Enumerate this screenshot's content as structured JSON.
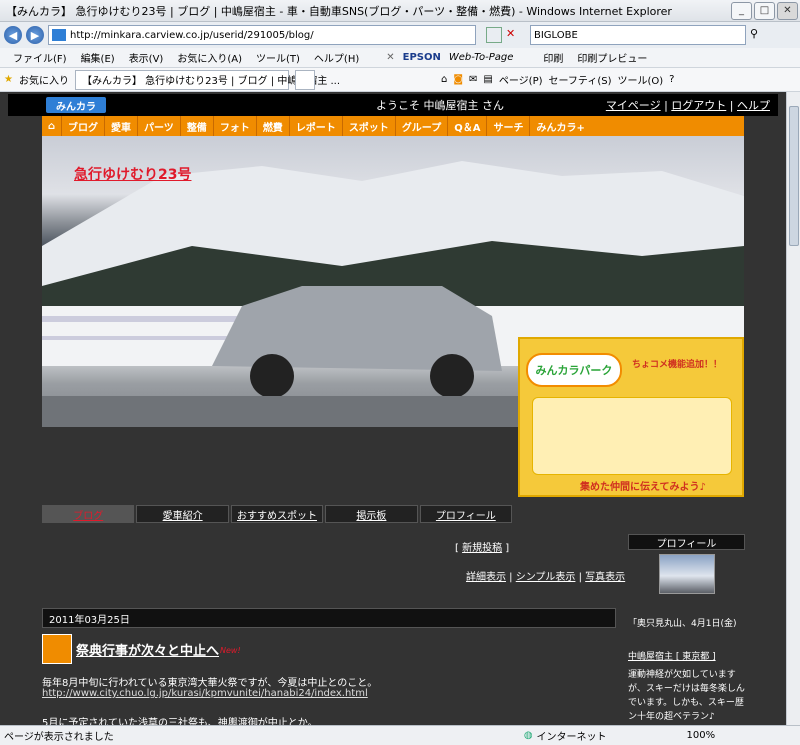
{
  "window": {
    "title": "【みんカラ】 急行ゆけむり23号 | ブログ | 中嶋屋宿主 - 車・自動車SNS(ブログ・パーツ・整備・燃費) - Windows Internet Explorer"
  },
  "address": {
    "url": "http://minkara.carview.co.jp/userid/291005/blog/",
    "search_engine": "BIGLOBE"
  },
  "menu": [
    "ファイル(F)",
    "編集(E)",
    "表示(V)",
    "お気に入り(A)",
    "ツール(T)",
    "ヘルプ(H)"
  ],
  "toolbar": {
    "epson": "EPSON",
    "webtopage": "Web-To-Page",
    "print": "印刷",
    "preview": "印刷プレビュー"
  },
  "favbar": {
    "favorites": "お気に入り",
    "tab": "【みんカラ】 急行ゆけむり23号 | ブログ | 中嶋屋宿主 ...",
    "page": "ページ(P)",
    "safety": "セーフティ(S)",
    "tools": "ツール(O)"
  },
  "site": {
    "logo": "みんカラ",
    "welcome": "ようこそ 中嶋屋宿主 さん",
    "toplinks": [
      "マイページ",
      "ログアウト",
      "ヘルプ"
    ],
    "nav": [
      "ブログ",
      "愛車",
      "パーツ",
      "整備",
      "フォト",
      "燃費",
      "レポート",
      "スポット",
      "グループ",
      "Q＆A",
      "サーチ",
      "みんカラ+"
    ]
  },
  "blog": {
    "title": "急行ゆけむり23号"
  },
  "ad": {
    "logo": "みんカラパーク",
    "line1": "ちょコメ機能追加！！",
    "line2": "集めた仲間に伝えてみよう♪"
  },
  "blogtabs": [
    "ブログ",
    "愛車紹介",
    "おすすめスポット",
    "掲示板",
    "プロフィール"
  ],
  "post": {
    "new_post": "新規投稿",
    "views": [
      "詳細表示",
      "シンプル表示",
      "写真表示"
    ]
  },
  "entry": {
    "date": "2011年03月25日",
    "title": "祭典行事が次々と中止へ",
    "new_badge": "New!",
    "body1": "毎年8月中旬に行われている東京湾大華火祭ですが、今夏は中止とのこと。",
    "link": "http://www.city.chuo.lg.jp/kurasi/kpmvunitei/hanabi24/index.html",
    "body2": "5月に予定されていた浅草の三社祭も、神輿渡御が中止とか。"
  },
  "sidebar": {
    "header": "プロフィール",
    "quote": "「奥只見丸山、4月1日(金)",
    "name": "中嶋屋宿主 [ 東京都 ]",
    "text": "運動神経が欠如していますが、スキーだけは毎冬楽しんでいます。しかも、スキー歴ン十年の超ベテラン♪"
  },
  "status": {
    "left": "ページが表示されました",
    "zone": "インターネット",
    "zoom": "100%"
  }
}
